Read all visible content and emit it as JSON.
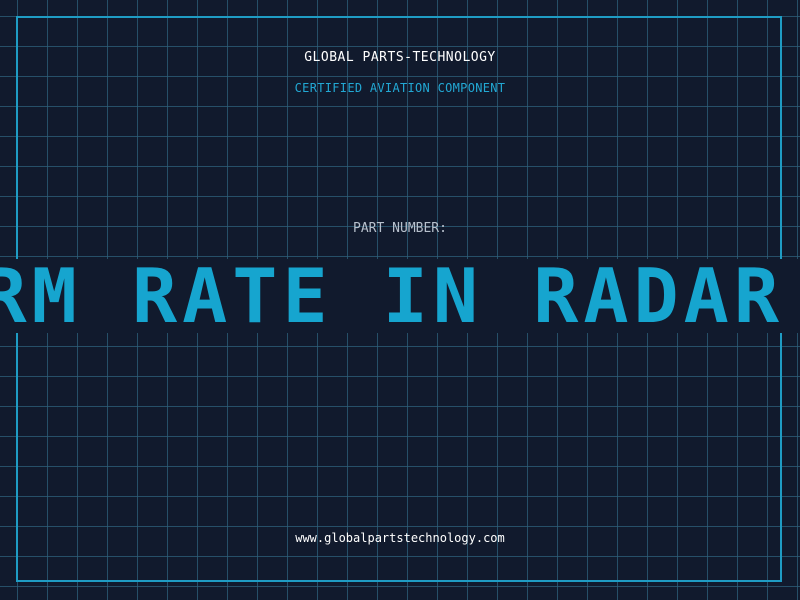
{
  "header": {
    "company": "GLOBAL PARTS-TECHNOLOGY",
    "subtitle": "CERTIFIED AVIATION COMPONENT"
  },
  "part": {
    "label": "PART NUMBER:",
    "value": "LARM RATE IN RADAR"
  },
  "footer": {
    "url": "www.globalpartstechnology.com"
  },
  "colors": {
    "background": "#111a2d",
    "grid": "#2e607c",
    "accent": "#16a5cf",
    "frame": "#1f9cc4"
  }
}
